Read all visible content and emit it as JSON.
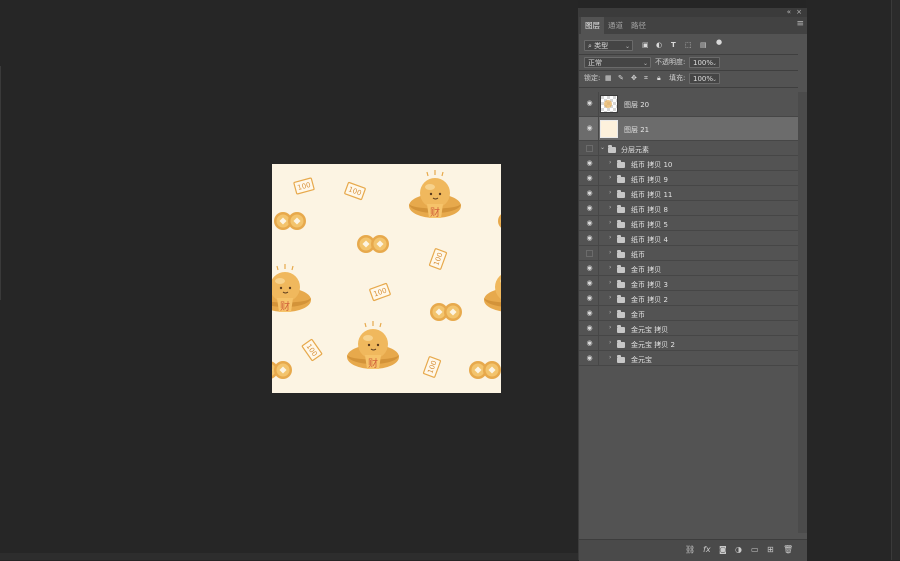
{
  "status_bar": {
    "text": ""
  },
  "panel": {
    "tabs": [
      {
        "label": "图层",
        "active": true
      },
      {
        "label": "通道",
        "active": false
      },
      {
        "label": "路径",
        "active": false
      }
    ],
    "filter": {
      "label": "类型",
      "icons": [
        "image-filter-icon",
        "adjustment-filter-icon",
        "text-filter-icon",
        "shape-filter-icon",
        "smart-object-filter-icon",
        "filter-toggle-icon"
      ]
    },
    "blend_mode": "正常",
    "opacity_label": "不透明度:",
    "opacity_value": "100%",
    "lock_label": "锁定:",
    "fill_label": "填充:",
    "fill_value": "100%",
    "layers": [
      {
        "name": "图层 20",
        "type": "pixel",
        "visible": true,
        "thumb": "pattern",
        "selected": false
      },
      {
        "name": "图层 21",
        "type": "pixel",
        "visible": true,
        "thumb": "solid",
        "selected": true
      },
      {
        "name": "分层元素",
        "type": "group-open",
        "visible": false,
        "selected": false
      },
      {
        "name": "纸币 拷贝 10",
        "type": "group",
        "visible": true
      },
      {
        "name": "纸币 拷贝 9",
        "type": "group",
        "visible": true
      },
      {
        "name": "纸币 拷贝 11",
        "type": "group",
        "visible": true
      },
      {
        "name": "纸币 拷贝 8",
        "type": "group",
        "visible": true
      },
      {
        "name": "纸币 拷贝 5",
        "type": "group",
        "visible": true
      },
      {
        "name": "纸币 拷贝 4",
        "type": "group",
        "visible": true
      },
      {
        "name": "纸币",
        "type": "group",
        "visible": false
      },
      {
        "name": "金币 拷贝",
        "type": "group",
        "visible": true
      },
      {
        "name": "金币 拷贝 3",
        "type": "group",
        "visible": true
      },
      {
        "name": "金币 拷贝 2",
        "type": "group",
        "visible": true
      },
      {
        "name": "金币",
        "type": "group",
        "visible": true
      },
      {
        "name": "金元宝 拷贝",
        "type": "group",
        "visible": true
      },
      {
        "name": "金元宝 拷贝 2",
        "type": "group",
        "visible": true
      },
      {
        "name": "金元宝",
        "type": "group",
        "visible": true
      }
    ],
    "bottom_icons": [
      "link-layers-icon",
      "fx-icon",
      "add-mask-icon",
      "adjustment-layer-icon",
      "new-group-icon",
      "new-layer-icon",
      "delete-layer-icon"
    ]
  },
  "canvas": {
    "background": "#fcf4e3",
    "note_text": "100",
    "ingot_text": "财"
  },
  "colors": {
    "gold": "#e7a94c",
    "gold_light": "#f3c46d",
    "ingot_red": "#d0603a",
    "panel": "#535353",
    "selected_layer": "#6c6c6c"
  }
}
